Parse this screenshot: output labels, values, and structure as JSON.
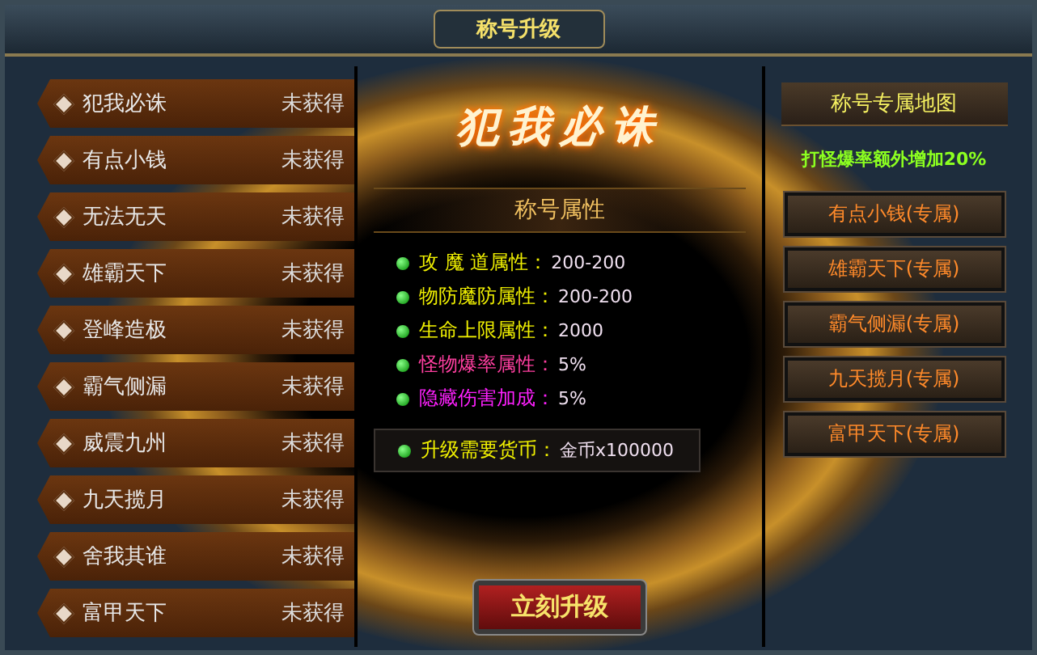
{
  "window": {
    "title": "称号升级"
  },
  "titles": [
    {
      "name": "犯我必诛",
      "status": "未获得"
    },
    {
      "name": "有点小钱",
      "status": "未获得"
    },
    {
      "name": "无法无天",
      "status": "未获得"
    },
    {
      "name": "雄霸天下",
      "status": "未获得"
    },
    {
      "name": "登峰造极",
      "status": "未获得"
    },
    {
      "name": "霸气侧漏",
      "status": "未获得"
    },
    {
      "name": "威震九州",
      "status": "未获得"
    },
    {
      "name": "九天揽月",
      "status": "未获得"
    },
    {
      "name": "舍我其谁",
      "status": "未获得"
    },
    {
      "name": "富甲天下",
      "status": "未获得"
    }
  ],
  "banner_title": "犯我必诛",
  "attributes": {
    "heading": "称号属性",
    "items": [
      {
        "label": "攻 魔 道属性：",
        "value": "200-200",
        "color": "#f0f000"
      },
      {
        "label": "物防魔防属性：",
        "value": "200-200",
        "color": "#f0f000"
      },
      {
        "label": "生命上限属性：",
        "value": "2000",
        "color": "#f0f000"
      },
      {
        "label": "怪物爆率属性：",
        "value": "5%",
        "color": "#ff3fa0"
      },
      {
        "label": "隐藏伤害加成：",
        "value": "5%",
        "color": "#ff20ff"
      }
    ],
    "cost": {
      "label": "升级需要货币：",
      "value": "金币x100000"
    }
  },
  "upgrade_button": "立刻升级",
  "maps": {
    "heading": "称号专属地图",
    "bonus": "打怪爆率额外增加20%",
    "buttons": [
      "有点小钱(专属)",
      "雄霸天下(专属)",
      "霸气侧漏(专属)",
      "九天揽月(专属)",
      "富甲天下(专属)"
    ]
  }
}
